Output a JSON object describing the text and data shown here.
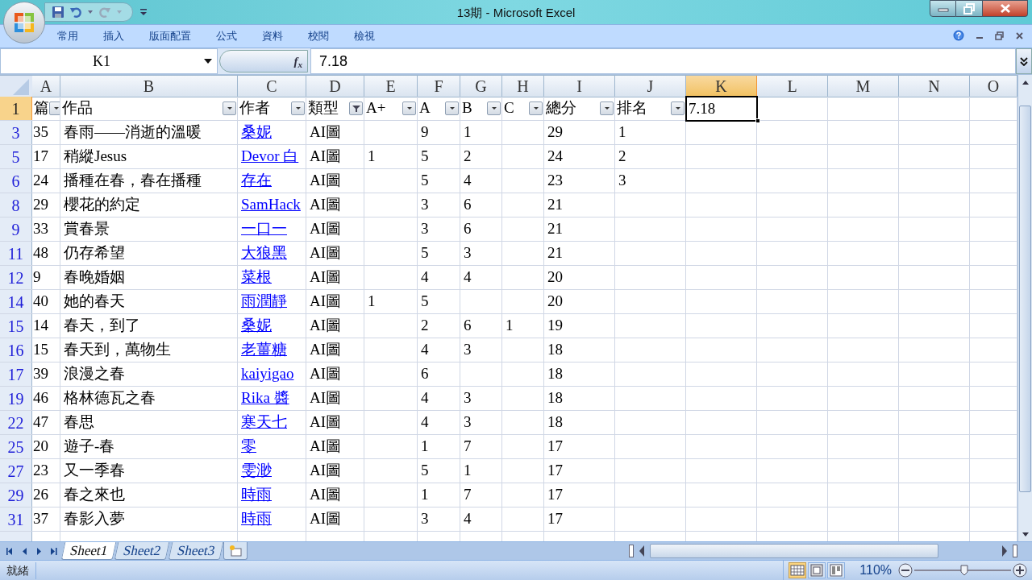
{
  "window": {
    "title": "13期 - Microsoft Excel"
  },
  "ribbon_tabs": [
    "常用",
    "插入",
    "版面配置",
    "公式",
    "資料",
    "校閱",
    "檢視"
  ],
  "name_box": "K1",
  "function_label": "f$_{x}$",
  "formula": "7.18",
  "columns": [
    {
      "label": "A",
      "selected": false
    },
    {
      "label": "B",
      "selected": false
    },
    {
      "label": "C",
      "selected": false
    },
    {
      "label": "D",
      "selected": false
    },
    {
      "label": "E",
      "selected": false
    },
    {
      "label": "F",
      "selected": false
    },
    {
      "label": "G",
      "selected": false
    },
    {
      "label": "H",
      "selected": false
    },
    {
      "label": "I",
      "selected": false
    },
    {
      "label": "J",
      "selected": false
    },
    {
      "label": "K",
      "selected": true
    },
    {
      "label": "L",
      "selected": false
    },
    {
      "label": "M",
      "selected": false
    },
    {
      "label": "N",
      "selected": false
    },
    {
      "label": "O",
      "selected": false
    }
  ],
  "header_row": {
    "number": "1",
    "selected": true,
    "cells": [
      {
        "kind": "filter",
        "text": "篇",
        "filtered": false
      },
      {
        "kind": "filter",
        "text": "作品",
        "filtered": false
      },
      {
        "kind": "filter",
        "text": "作者",
        "filtered": false
      },
      {
        "kind": "filter",
        "text": "類型",
        "filtered": true
      },
      {
        "kind": "filter",
        "text": "A+",
        "filtered": false
      },
      {
        "kind": "filter",
        "text": "A",
        "filtered": false
      },
      {
        "kind": "filter",
        "text": "B",
        "filtered": false
      },
      {
        "kind": "filter",
        "text": "C",
        "filtered": false
      },
      {
        "kind": "filter",
        "text": "總分",
        "filtered": false
      },
      {
        "kind": "filter",
        "text": "排名",
        "filtered": false
      },
      {
        "kind": "active",
        "text": "7.18"
      }
    ]
  },
  "rows": [
    {
      "number": "3",
      "filtered": true,
      "no": "35",
      "title": "春雨——消逝的溫暖",
      "author": "桑妮",
      "type": "AI圖",
      "a": "9",
      "b": "1",
      "total": "29",
      "rank": "1"
    },
    {
      "number": "5",
      "filtered": true,
      "no": "17",
      "title": "稍縱Jesus",
      "author": "Devor 白",
      "type": "AI圖",
      "a_plus": "1",
      "a": "5",
      "b": "2",
      "total": "24",
      "rank": "2"
    },
    {
      "number": "6",
      "filtered": true,
      "no": "24",
      "title": "播種在春，春在播種",
      "author": "存在",
      "type": "AI圖",
      "a": "5",
      "b": "4",
      "total": "23",
      "rank": "3"
    },
    {
      "number": "8",
      "filtered": true,
      "no": "29",
      "title": "櫻花的約定",
      "author": "SamHack",
      "type": "AI圖",
      "a": "3",
      "b": "6",
      "total": "21"
    },
    {
      "number": "9",
      "filtered": true,
      "no": "33",
      "title": "賞春景",
      "author": "一口一",
      "type": "AI圖",
      "a": "3",
      "b": "6",
      "total": "21"
    },
    {
      "number": "11",
      "filtered": true,
      "no": "48",
      "title": "仍存希望",
      "author": "大狼黑",
      "type": "AI圖",
      "a": "5",
      "b": "3",
      "total": "21"
    },
    {
      "number": "12",
      "filtered": true,
      "no": "9",
      "title": "春晚婚姻",
      "author": "菜根",
      "type": "AI圖",
      "a": "4",
      "b": "4",
      "total": "20"
    },
    {
      "number": "14",
      "filtered": true,
      "no": "40",
      "title": "她的春天",
      "author": "雨潤靜",
      "type": "AI圖",
      "a_plus": "1",
      "a": "5",
      "total": "20"
    },
    {
      "number": "15",
      "filtered": true,
      "no": "14",
      "title": "春天，到了",
      "author": "桑妮",
      "type": "AI圖",
      "a": "2",
      "b": "6",
      "c": "1",
      "total": "19"
    },
    {
      "number": "16",
      "filtered": true,
      "no": "15",
      "title": "春天到，萬物生",
      "author": "老薑糖",
      "type": "AI圖",
      "a": "4",
      "b": "3",
      "total": "18"
    },
    {
      "number": "17",
      "filtered": true,
      "no": "39",
      "title": "浪漫之春",
      "author": "kaiyigao",
      "type": "AI圖",
      "a": "6",
      "total": "18"
    },
    {
      "number": "19",
      "filtered": true,
      "no": "46",
      "title": "格林德瓦之春",
      "author": "Rika 醬",
      "type": "AI圖",
      "a": "4",
      "b": "3",
      "total": "18"
    },
    {
      "number": "22",
      "filtered": true,
      "no": "47",
      "title": "春思",
      "author": "寒天七",
      "type": "AI圖",
      "a": "4",
      "b": "3",
      "total": "18"
    },
    {
      "number": "25",
      "filtered": true,
      "no": "20",
      "title": "遊子-春",
      "author": "零",
      "type": "AI圖",
      "a": "1",
      "b": "7",
      "total": "17"
    },
    {
      "number": "27",
      "filtered": true,
      "no": "23",
      "title": "又一季春",
      "author": "雯渺",
      "type": "AI圖",
      "a": "5",
      "b": "1",
      "total": "17"
    },
    {
      "number": "29",
      "filtered": true,
      "no": "26",
      "title": "春之來也",
      "author": "時雨",
      "type": "AI圖",
      "a": "1",
      "b": "7",
      "total": "17"
    },
    {
      "number": "31",
      "filtered": true,
      "no": "37",
      "title": "春影入夢",
      "author": "時雨",
      "type": "AI圖",
      "a": "3",
      "b": "4",
      "total": "17"
    }
  ],
  "sheets": [
    {
      "label": "Sheet1",
      "selected": true
    },
    {
      "label": "Sheet2",
      "selected": false
    },
    {
      "label": "Sheet3",
      "selected": false
    }
  ],
  "status": "就緒",
  "view_modes": [
    {
      "kind": "normal",
      "selected": true
    },
    {
      "kind": "layout",
      "selected": false
    },
    {
      "kind": "pagebreak",
      "selected": false
    }
  ],
  "zoom": {
    "label": "110%",
    "level": 0.52
  }
}
